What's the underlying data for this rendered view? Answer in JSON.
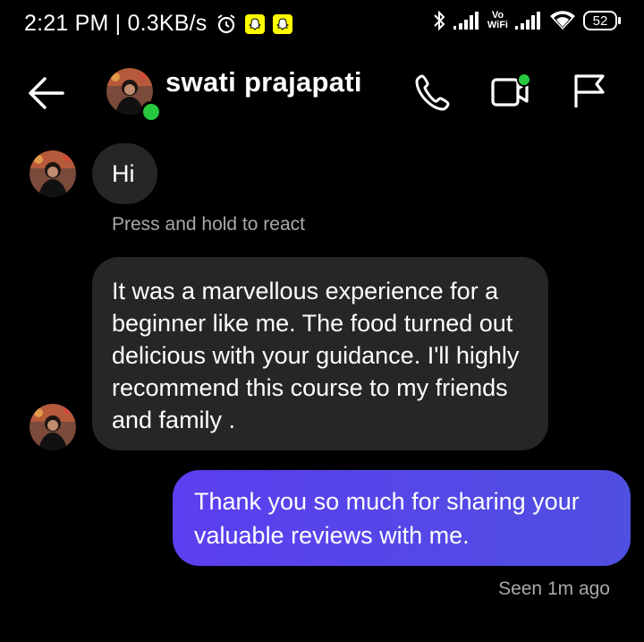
{
  "status_bar": {
    "time_speed": "2:21 PM | 0.3KB/s",
    "vowifi_top": "Vo",
    "vowifi_bottom": "WiFi",
    "battery": "52",
    "icons": [
      "alarm-icon",
      "snapchat-icon",
      "snapchat-icon",
      "bluetooth-icon",
      "signal-icon",
      "vowifi-icon",
      "signal-icon",
      "wifi-icon",
      "battery-icon"
    ]
  },
  "header": {
    "contact_name": "swati prajapati",
    "online": true,
    "icons": [
      "back-arrow-icon",
      "phone-icon",
      "video-call-icon",
      "flag-icon"
    ]
  },
  "messages": [
    {
      "from": "them",
      "text": "Hi"
    },
    {
      "from": "them",
      "text": "It was a marvellous experience for a beginner like me. The food turned out delicious with your guidance. I'll highly recommend this course to my friends and family ."
    },
    {
      "from": "me",
      "text": "Thank you so much for sharing your valuable reviews with me."
    }
  ],
  "hint_text": "Press and hold to react",
  "seen_text": "Seen 1m ago",
  "colors": {
    "background": "#000000",
    "incoming_bubble": "#262626",
    "outgoing_bubble": "#5141E8",
    "online_dot": "#27C93F",
    "muted_text": "#A8A8A8"
  }
}
